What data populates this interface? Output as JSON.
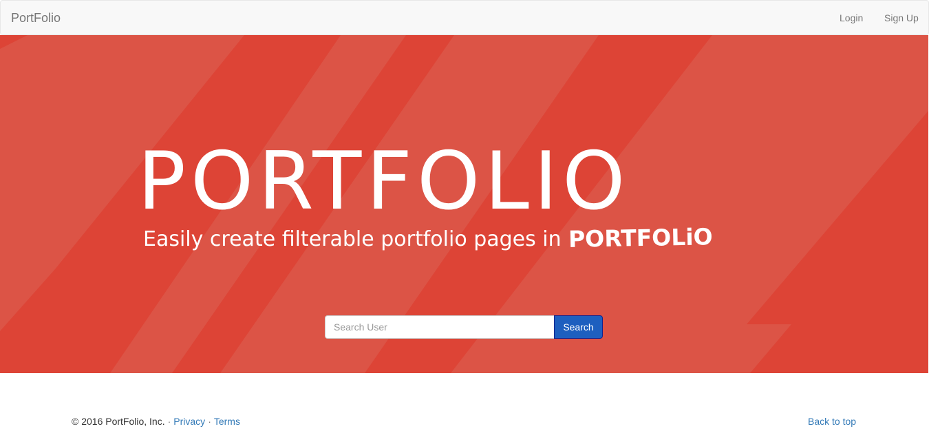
{
  "navbar": {
    "brand": "PortFolio",
    "links": [
      {
        "label": "Login"
      },
      {
        "label": "Sign Up"
      }
    ]
  },
  "hero": {
    "title": "PORTFOLIO",
    "subtitle": "Easily create filterable portfolio pages in",
    "subtitle_logo": "PORTFOLiO",
    "bg_color": "#dc5446",
    "stripe_color": "#dd4436"
  },
  "search": {
    "placeholder": "Search User",
    "value": "",
    "button_label": "Search",
    "button_color": "#1e5fbf"
  },
  "footer": {
    "copyright": "© 2016 PortFolio, Inc.",
    "separator": "·",
    "privacy": "Privacy",
    "terms": "Terms",
    "back_to_top": "Back to top",
    "link_color": "#337ab7"
  }
}
